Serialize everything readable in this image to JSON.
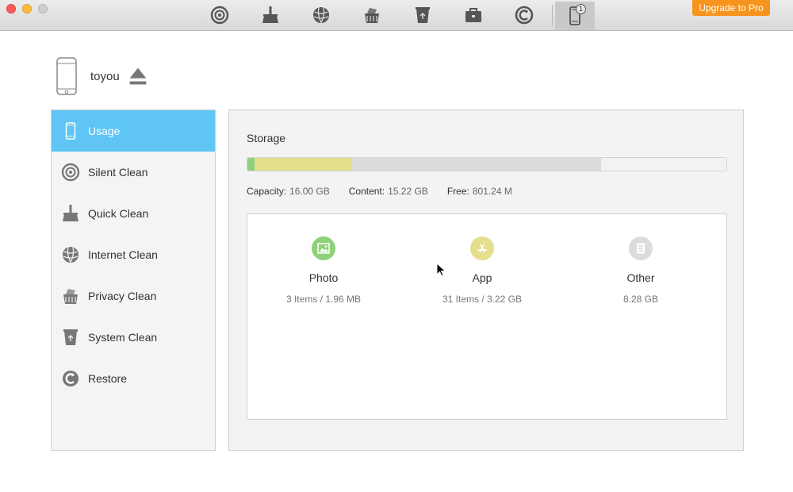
{
  "toolbar": {
    "upgrade_label": "Upgrade to Pro",
    "device_badge": "1",
    "icons": [
      "silent-clean-icon",
      "quick-clean-icon",
      "internet-clean-icon",
      "privacy-clean-icon",
      "system-clean-icon",
      "toolbox-icon",
      "restore-icon",
      "iphone-icon"
    ]
  },
  "device": {
    "name": "toyou"
  },
  "sidebar": {
    "items": [
      {
        "label": "Usage",
        "icon": "iphone-icon",
        "active": true
      },
      {
        "label": "Silent Clean",
        "icon": "silent-clean-icon"
      },
      {
        "label": "Quick Clean",
        "icon": "quick-clean-icon"
      },
      {
        "label": "Internet Clean",
        "icon": "internet-clean-icon"
      },
      {
        "label": "Privacy Clean",
        "icon": "privacy-clean-icon"
      },
      {
        "label": "System Clean",
        "icon": "system-clean-icon"
      },
      {
        "label": "Restore",
        "icon": "restore-icon"
      }
    ]
  },
  "storage": {
    "title": "Storage",
    "capacity_label": "Capacity:",
    "capacity_value": "16.00 GB",
    "content_label": "Content:",
    "content_value": "15.22 GB",
    "free_label": "Free:",
    "free_value": "801.24 M",
    "bar_segments": [
      {
        "name": "photo",
        "fraction": 0.015,
        "color": "#8fd17a"
      },
      {
        "name": "app",
        "fraction": 0.203,
        "color": "#e4df8d"
      },
      {
        "name": "other",
        "fraction": 0.52,
        "color": "#dcdcdc"
      }
    ]
  },
  "categories": [
    {
      "name": "Photo",
      "detail": "3 Items / 1.96 MB",
      "color": "#8fd17a",
      "icon": "photo-icon"
    },
    {
      "name": "App",
      "detail": "31 Items / 3.22 GB",
      "color": "#e4df8d",
      "icon": "app-store-icon"
    },
    {
      "name": "Other",
      "detail": "8.28 GB",
      "color": "#dcdcdc",
      "icon": "document-icon"
    }
  ],
  "colors": {
    "accent": "#5ec5f5",
    "upgrade": "#f7941d"
  }
}
